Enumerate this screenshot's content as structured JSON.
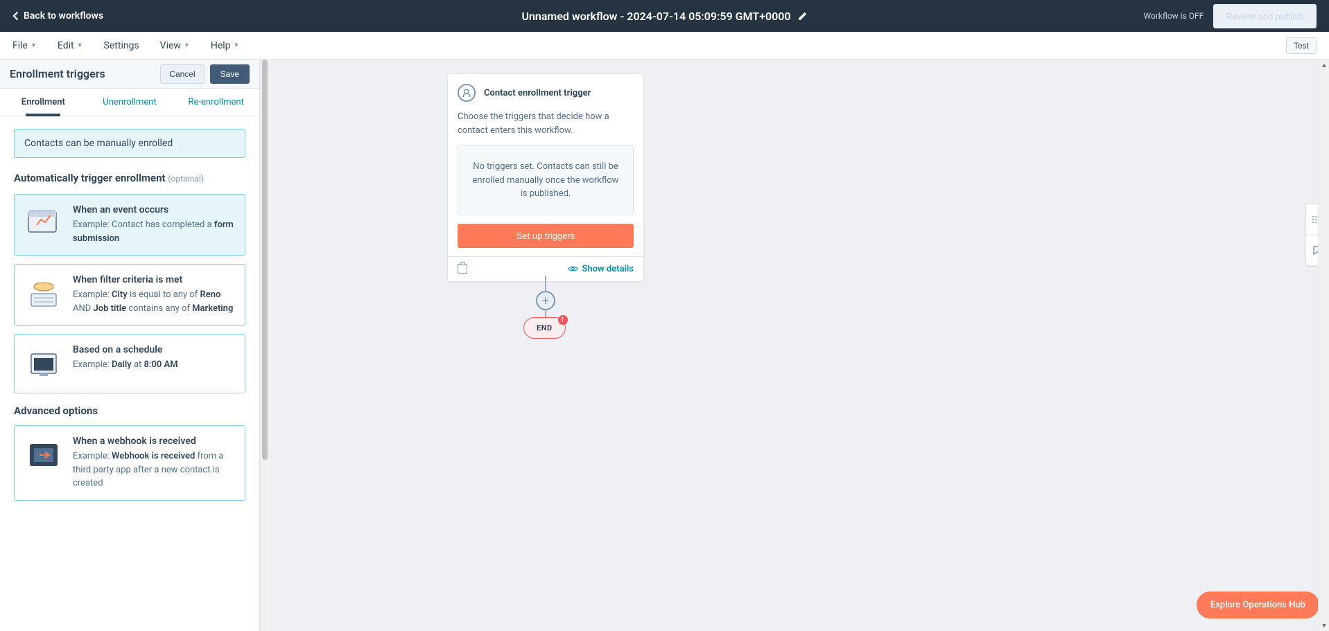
{
  "topbar": {
    "back": "Back to workflows",
    "title": "Unnamed workflow - 2024-07-14 05:09:59 GMT+0000",
    "status": "Workflow is OFF",
    "review": "Review and publish"
  },
  "menubar": {
    "file": "File",
    "edit": "Edit",
    "settings": "Settings",
    "view": "View",
    "help": "Help",
    "test": "Test"
  },
  "sidebar": {
    "title": "Enrollment triggers",
    "cancel": "Cancel",
    "save": "Save",
    "tabs": {
      "enroll": "Enrollment",
      "unenroll": "Unenrollment",
      "reenroll": "Re-enrollment"
    },
    "alert": "Contacts can be manually enrolled",
    "auto_title": "Automatically trigger enrollment",
    "optional": "(optional)",
    "cards": {
      "event": {
        "title": "When an event occurs",
        "ex_pre": "Example: Contact has completed a ",
        "ex_b": "form submission"
      },
      "filter": {
        "title": "When filter criteria is met",
        "ex_pre": "Example: ",
        "b1": "City",
        "t1": " is equal to any of ",
        "b2": "Reno",
        "t2": " AND ",
        "b3": "Job title",
        "t3": " contains any of ",
        "b4": "Marketing"
      },
      "schedule": {
        "title": "Based on a schedule",
        "ex_pre": "Example: ",
        "b1": "Daily",
        "t1": " at ",
        "b2": "8:00 AM"
      },
      "advanced_title": "Advanced options",
      "webhook": {
        "title": "When a webhook is received",
        "ex_pre": "Example: ",
        "b1": "Webhook is received",
        "t1": " from a third party app after a new contact is created"
      }
    }
  },
  "trigger": {
    "title": "Contact enrollment trigger",
    "desc": "Choose the triggers that decide how a contact enters this workflow.",
    "empty": "No triggers set. Contacts can still be enrolled manually once the workflow is published.",
    "setup": "Set up triggers",
    "show": "Show details"
  },
  "canvas": {
    "end": "END"
  },
  "explore": "Explore Operations Hub"
}
